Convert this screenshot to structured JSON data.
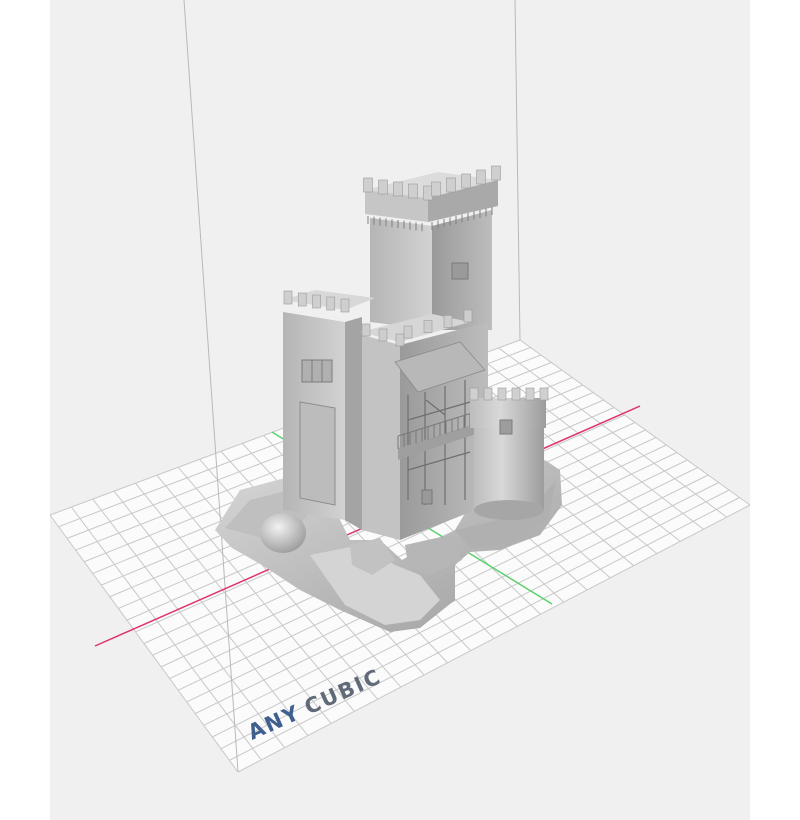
{
  "viewer": {
    "brand_left": "ANY",
    "brand_right": "CUBIC",
    "model": "castle-tower"
  },
  "colors": {
    "background": "#f0f0f0",
    "plate": "#fbfbfb",
    "grid": "#c8c8c8",
    "x_axis": "#e0326e",
    "y_axis": "#5ad26e",
    "model_light": "#c9c9c9",
    "model_mid": "#a9a9a9",
    "model_dark": "#8a8a8a",
    "brand_dark": "#3f5f8f",
    "brand_light": "#606a78"
  }
}
